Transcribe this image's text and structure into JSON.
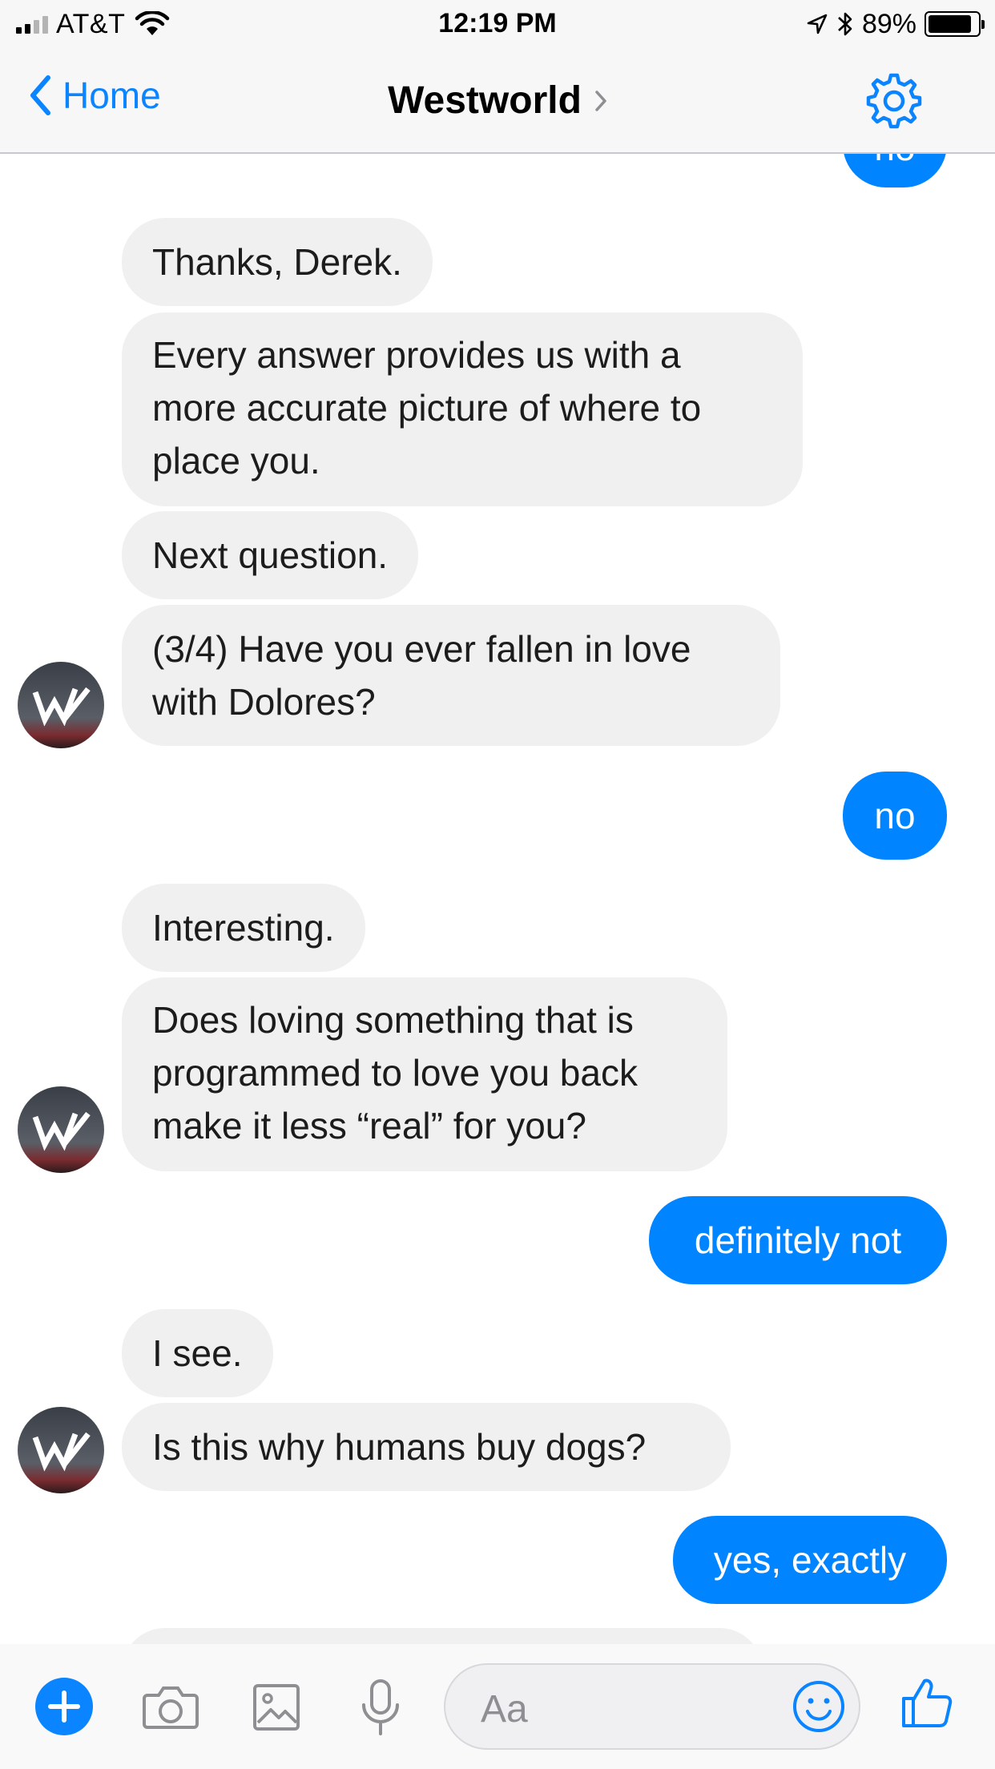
{
  "status_bar": {
    "carrier": "AT&T",
    "time": "12:19 PM",
    "battery_percent": "89%",
    "battery_level": 0.89,
    "signal_bars": 2
  },
  "nav": {
    "back_label": "Home",
    "title": "Westworld",
    "settings_icon": "gear-icon"
  },
  "messages": [
    {
      "from": "me",
      "text": "no"
    },
    {
      "from": "bot",
      "text": "Thanks, Derek."
    },
    {
      "from": "bot",
      "lines": [
        "Every answer provides us with a",
        "more accurate picture of where to",
        "place you."
      ]
    },
    {
      "from": "bot",
      "text": "Next question."
    },
    {
      "from": "bot",
      "lines": [
        "(3/4) Have you ever fallen in love",
        "with Dolores?"
      ]
    },
    {
      "from": "me",
      "text": "no"
    },
    {
      "from": "bot",
      "text": "Interesting."
    },
    {
      "from": "bot",
      "lines": [
        "Does loving something that is",
        "programmed to love you back",
        "make it less “real” for you?"
      ]
    },
    {
      "from": "me",
      "text": "definitely not"
    },
    {
      "from": "bot",
      "text": "I see."
    },
    {
      "from": "bot",
      "text": "Is this why humans buy dogs?"
    },
    {
      "from": "me",
      "text": "yes, exactly"
    }
  ],
  "composer": {
    "placeholder": "Aa",
    "icons": [
      "plus-icon",
      "camera-icon",
      "image-icon",
      "microphone-icon",
      "emoji-icon",
      "thumbs-up-icon"
    ]
  },
  "colors": {
    "accent": "#0084ff",
    "incoming_bubble": "#f0f0f0",
    "bar_background": "#f7f7f7"
  }
}
